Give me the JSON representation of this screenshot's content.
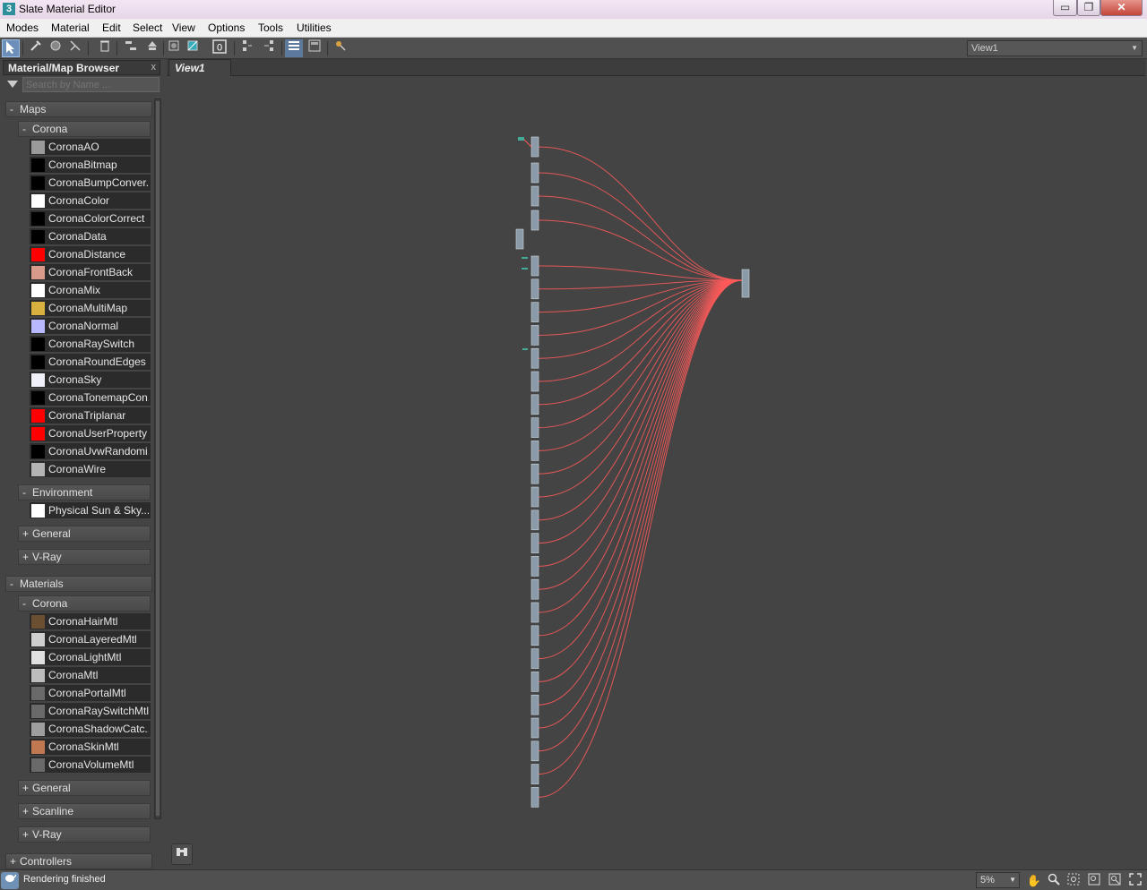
{
  "window": {
    "title": "Slate Material Editor",
    "app_icon": "3",
    "minimize": "▭",
    "maximize": "❐",
    "close": "✕"
  },
  "menu": [
    "Modes",
    "Material",
    "Edit",
    "Select",
    "View",
    "Options",
    "Tools",
    "Utilities"
  ],
  "toolbar": {
    "view_selector": "View1"
  },
  "browser": {
    "title": "Material/Map Browser",
    "close": "x",
    "search_placeholder": "Search by Name ...",
    "maps_label": "Maps",
    "maps_sign": "-",
    "maps_corona_label": "Corona",
    "maps_corona_sign": "-",
    "maps_items": [
      {
        "label": "CoronaAO",
        "swatch": "#9a9a9a"
      },
      {
        "label": "CoronaBitmap",
        "swatch": "#000000"
      },
      {
        "label": "CoronaBumpConver...",
        "swatch": "#000000"
      },
      {
        "label": "CoronaColor",
        "swatch": "#ffffff"
      },
      {
        "label": "CoronaColorCorrect",
        "swatch": "#000000"
      },
      {
        "label": "CoronaData",
        "swatch": "#000000"
      },
      {
        "label": "CoronaDistance",
        "swatch": "#ff0000"
      },
      {
        "label": "CoronaFrontBack",
        "swatch": "#d89a8a"
      },
      {
        "label": "CoronaMix",
        "swatch": "#ffffff"
      },
      {
        "label": "CoronaMultiMap",
        "swatch": "#d8b040"
      },
      {
        "label": "CoronaNormal",
        "swatch": "#b8b8ff"
      },
      {
        "label": "CoronaRaySwitch",
        "swatch": "#000000"
      },
      {
        "label": "CoronaRoundEdges",
        "swatch": "#000000"
      },
      {
        "label": "CoronaSky",
        "swatch": "#f0f0f8"
      },
      {
        "label": "CoronaTonemapCon...",
        "swatch": "#000000"
      },
      {
        "label": "CoronaTriplanar",
        "swatch": "#ff0000"
      },
      {
        "label": "CoronaUserProperty",
        "swatch": "#ff0000"
      },
      {
        "label": "CoronaUvwRandomi...",
        "swatch": "#000000"
      },
      {
        "label": "CoronaWire",
        "swatch": "#b4b4b4"
      }
    ],
    "env_label": "Environment",
    "env_sign": "-",
    "env_items": [
      {
        "label": "Physical Sun & Sky...",
        "swatch": "#ffffff"
      }
    ],
    "maps_general": "General",
    "maps_vray": "V-Ray",
    "plus": "+",
    "materials_label": "Materials",
    "materials_sign": "-",
    "mat_corona_label": "Corona",
    "mat_corona_sign": "-",
    "mat_items": [
      {
        "label": "CoronaHairMtl",
        "swatch": "#6a5030"
      },
      {
        "label": "CoronaLayeredMtl",
        "swatch": "#cfcfcf"
      },
      {
        "label": "CoronaLightMtl",
        "swatch": "#e0e0e0"
      },
      {
        "label": "CoronaMtl",
        "swatch": "#bdbdbd"
      },
      {
        "label": "CoronaPortalMtl",
        "swatch": "#6a6a6a"
      },
      {
        "label": "CoronaRaySwitchMtl",
        "swatch": "#6a6a6a"
      },
      {
        "label": "CoronaShadowCatc...",
        "swatch": "#9e9e9e"
      },
      {
        "label": "CoronaSkinMtl",
        "swatch": "#c07850"
      },
      {
        "label": "CoronaVolumeMtl",
        "swatch": "#6a6a6a"
      }
    ],
    "mat_general": "General",
    "mat_scanline": "Scanline",
    "mat_vray": "V-Ray",
    "controllers": "Controllers"
  },
  "view_tab": "View1",
  "status": {
    "text": "Rendering finished",
    "zoom": "5%"
  },
  "colors": {
    "wire": "#ff5a5a",
    "node": "#8a9aa8",
    "accent": "#6b8fb8"
  }
}
